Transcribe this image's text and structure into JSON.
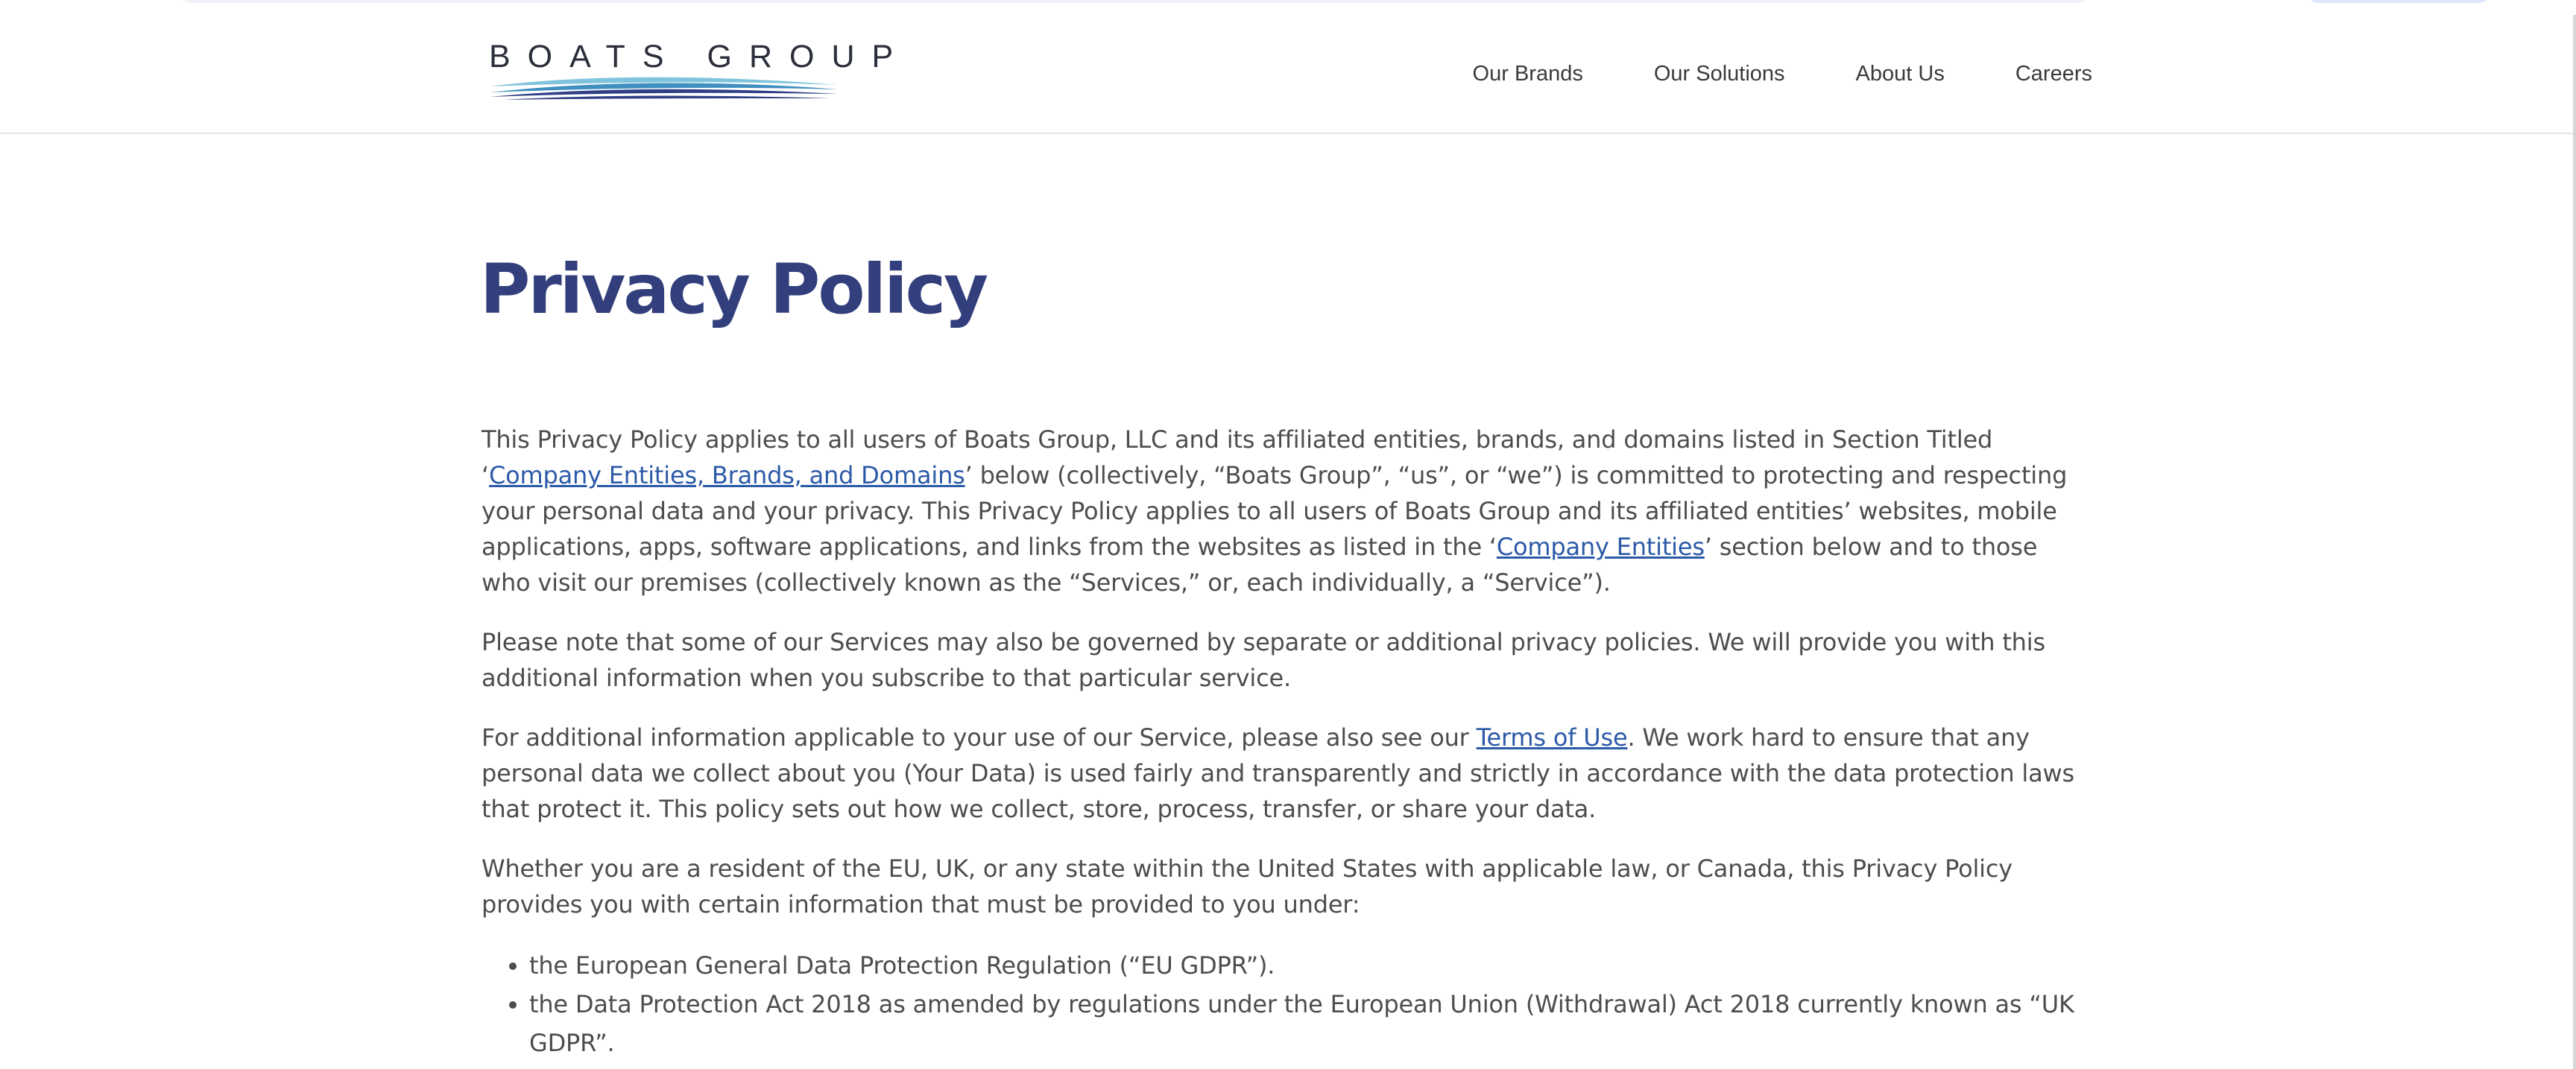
{
  "header": {
    "logo_text": "BOATS GROUP",
    "nav": [
      {
        "label": "Our Brands"
      },
      {
        "label": "Our Solutions"
      },
      {
        "label": "About Us"
      },
      {
        "label": "Careers"
      }
    ]
  },
  "main": {
    "title": "Privacy Policy",
    "p1": {
      "a": "This Privacy Policy applies to all users of Boats Group, LLC and its affiliated entities, brands, and domains listed in Section Titled ‘",
      "link1": "Company Entities, Brands, and Domains",
      "b": "’ below (collectively, “Boats Group”, “us”, or “we”) is committed to protecting and respecting your personal data and your privacy. This Privacy Policy applies to all users of Boats Group and its affiliated entities’ websites, mobile applications, apps, software applications, and links from the websites as listed in the ‘",
      "link2": "Company Entities",
      "c": "’ section below and to those who visit our premises (collectively known as the “Services,” or, each individually, a “Service”)."
    },
    "p2": "Please note that some of our Services may also be governed by separate or additional privacy policies. We will provide you with this additional information when you subscribe to that particular service.",
    "p3": {
      "a": "For additional information applicable to your use of our Service, please also see our ",
      "link": "Terms of Use",
      "b": ". We work hard to ensure that any personal data we collect about you (Your Data) is used fairly and transparently and strictly in accordance with the data protection laws that protect it. This policy sets out how we collect, store, process, transfer, or share your data."
    },
    "p4": "Whether you are a resident of the EU, UK, or any state within the United States with applicable law, or Canada, this Privacy Policy provides you with certain information that must be provided to you under:",
    "list": [
      "the European General Data Protection Regulation (“EU GDPR”).",
      "the Data Protection Act 2018 as amended by regulations under the European Union (Withdrawal) Act 2018 currently known as “UK GDPR”."
    ]
  },
  "colors": {
    "title": "#323f7c",
    "link": "#2b5aa8",
    "text": "#4d4d4d",
    "logo_wave_dark": "#2f3f86",
    "logo_wave_light": "#7fc4dc"
  }
}
